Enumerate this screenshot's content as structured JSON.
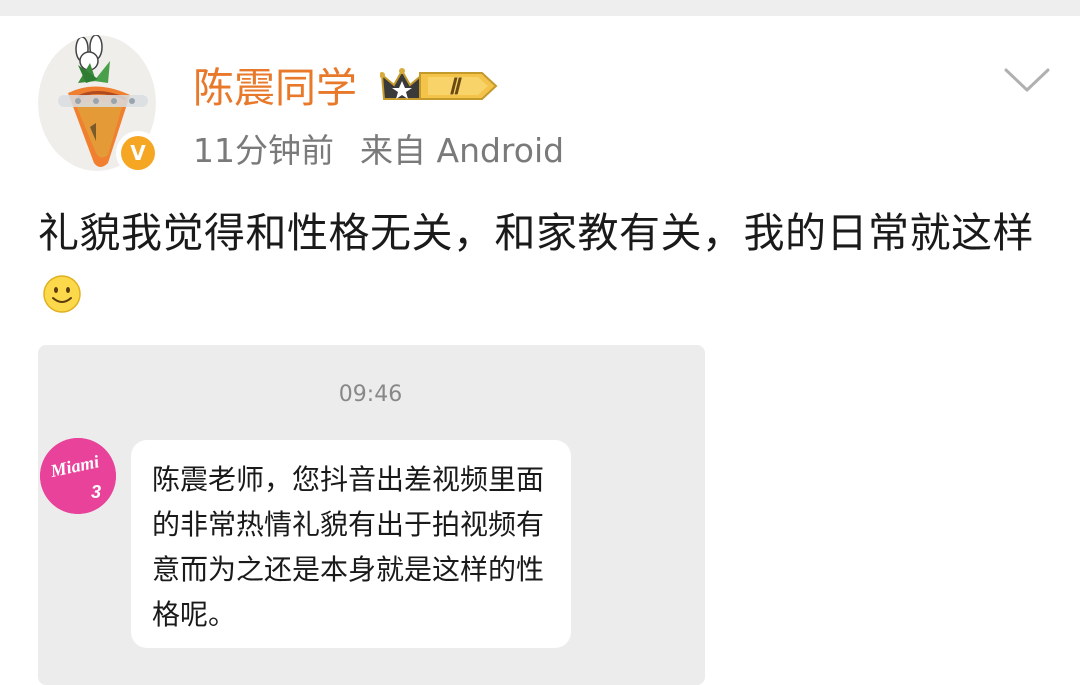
{
  "post": {
    "username": "陈震同学",
    "level_badge": "Ⅱ",
    "verified_badge": "V",
    "time_ago": "11分钟前",
    "source": "来自 Android",
    "text": "礼貌我觉得和性格无关，和家教有关，我的日常就这样",
    "emoji": "smile-emoji"
  },
  "card": {
    "time": "09:46",
    "sender_avatar_text": "Miami 3",
    "message": "陈震老师，您抖音出差视频里面的非常热情礼貌有出于拍视频有意而为之还是本身就是这样的性格呢。"
  },
  "colors": {
    "username": "#e8792b",
    "meta": "#7a7a7a",
    "card_bg": "#ececec",
    "sender_avatar_bg": "#e8429a",
    "verified_badge": "#f5a623"
  }
}
